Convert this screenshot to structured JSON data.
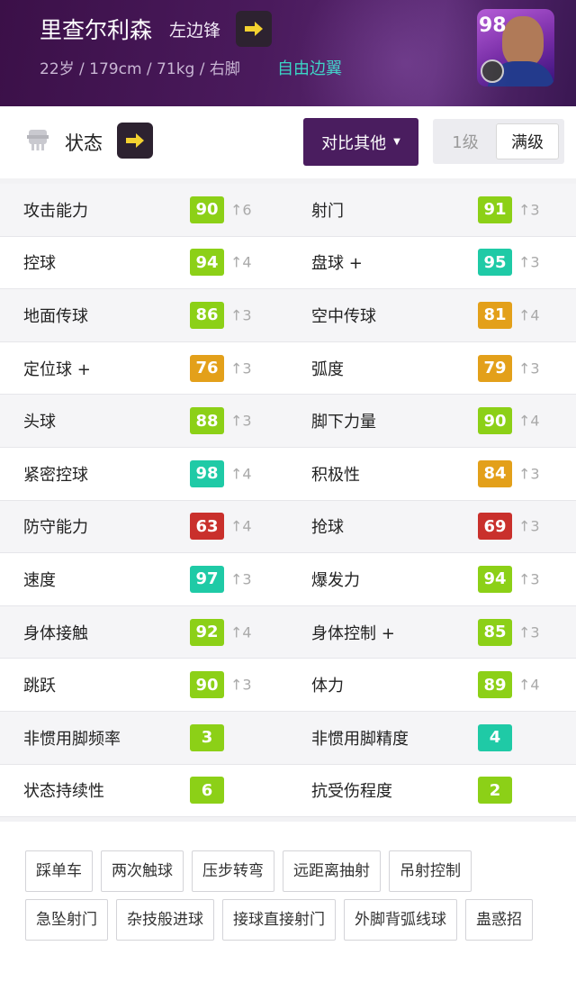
{
  "player": {
    "name": "里查尔利森",
    "position": "左边锋",
    "meta": "22岁 / 179cm / 71kg / 右脚",
    "playstyle": "自由边翼",
    "overall": "98"
  },
  "toolbar": {
    "status_label": "状态",
    "compare_label": "对比其他",
    "level_1": "1级",
    "level_max": "满级"
  },
  "colors": {
    "green": "#8cd017",
    "teal": "#1fcaa6",
    "orange": "#e3a01a",
    "red": "#c9302c",
    "header": "#4a1a5c"
  },
  "stats": [
    [
      {
        "label": "攻击能力",
        "value": "90",
        "inc": "↑6",
        "color": "green"
      },
      {
        "label": "射门",
        "value": "91",
        "inc": "↑3",
        "color": "green"
      }
    ],
    [
      {
        "label": "控球",
        "value": "94",
        "inc": "↑4",
        "color": "green"
      },
      {
        "label": "盘球 +",
        "value": "95",
        "inc": "↑3",
        "color": "teal"
      }
    ],
    [
      {
        "label": "地面传球",
        "value": "86",
        "inc": "↑3",
        "color": "green"
      },
      {
        "label": "空中传球",
        "value": "81",
        "inc": "↑4",
        "color": "orange"
      }
    ],
    [
      {
        "label": "定位球 +",
        "value": "76",
        "inc": "↑3",
        "color": "orange"
      },
      {
        "label": "弧度",
        "value": "79",
        "inc": "↑3",
        "color": "orange"
      }
    ],
    [
      {
        "label": "头球",
        "value": "88",
        "inc": "↑3",
        "color": "green"
      },
      {
        "label": "脚下力量",
        "value": "90",
        "inc": "↑4",
        "color": "green"
      }
    ],
    [
      {
        "label": "紧密控球",
        "value": "98",
        "inc": "↑4",
        "color": "teal"
      },
      {
        "label": "积极性",
        "value": "84",
        "inc": "↑3",
        "color": "orange"
      }
    ],
    [
      {
        "label": "防守能力",
        "value": "63",
        "inc": "↑4",
        "color": "red"
      },
      {
        "label": "抢球",
        "value": "69",
        "inc": "↑3",
        "color": "red"
      }
    ],
    [
      {
        "label": "速度",
        "value": "97",
        "inc": "↑3",
        "color": "teal"
      },
      {
        "label": "爆发力",
        "value": "94",
        "inc": "↑3",
        "color": "green"
      }
    ],
    [
      {
        "label": "身体接触",
        "value": "92",
        "inc": "↑4",
        "color": "green"
      },
      {
        "label": "身体控制 +",
        "value": "85",
        "inc": "↑3",
        "color": "green"
      }
    ],
    [
      {
        "label": "跳跃",
        "value": "90",
        "inc": "↑3",
        "color": "green"
      },
      {
        "label": "体力",
        "value": "89",
        "inc": "↑4",
        "color": "green"
      }
    ],
    [
      {
        "label": "非惯用脚频率",
        "value": "3",
        "inc": "",
        "color": "green"
      },
      {
        "label": "非惯用脚精度",
        "value": "4",
        "inc": "",
        "color": "teal"
      }
    ],
    [
      {
        "label": "状态持续性",
        "value": "6",
        "inc": "",
        "color": "green"
      },
      {
        "label": "抗受伤程度",
        "value": "2",
        "inc": "",
        "color": "green"
      }
    ]
  ],
  "skills": [
    "踩单车",
    "两次触球",
    "压步转弯",
    "远距离抽射",
    "吊射控制",
    "急坠射门",
    "杂技般进球",
    "接球直接射门",
    "外脚背弧线球",
    "蛊惑招"
  ]
}
